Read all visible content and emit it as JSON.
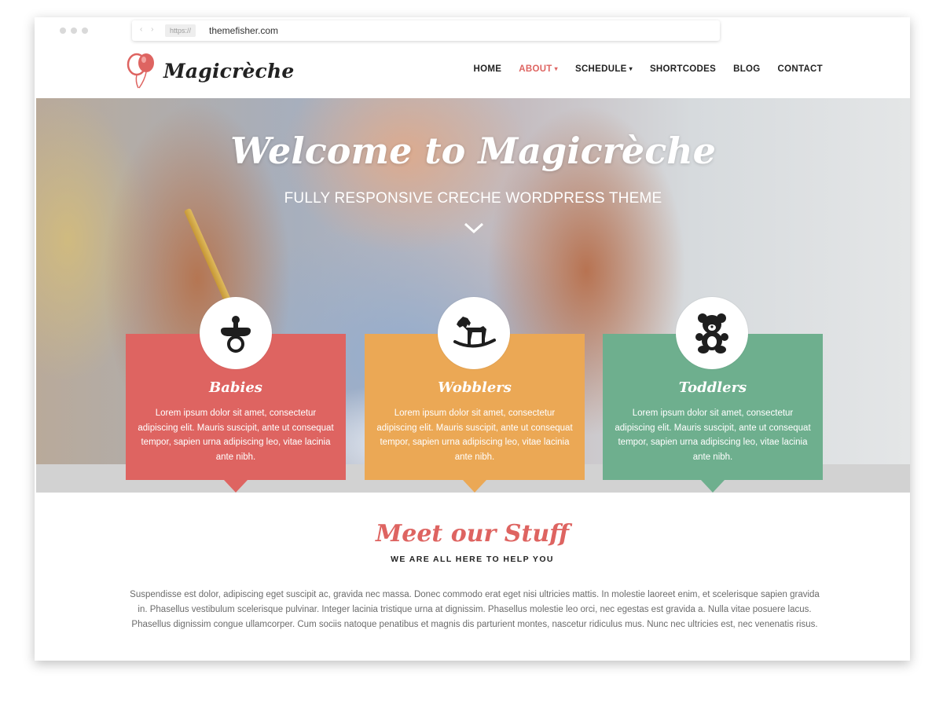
{
  "browser": {
    "url_protocol": "https://",
    "url_host": "themefisher.com"
  },
  "header": {
    "logo_text": "Magicrèche",
    "nav": [
      {
        "label": "HOME",
        "active": false,
        "dropdown": false
      },
      {
        "label": "ABOUT",
        "active": true,
        "dropdown": true
      },
      {
        "label": "SCHEDULE",
        "active": false,
        "dropdown": true
      },
      {
        "label": "SHORTCODES",
        "active": false,
        "dropdown": false
      },
      {
        "label": "BLOG",
        "active": false,
        "dropdown": false
      },
      {
        "label": "CONTACT",
        "active": false,
        "dropdown": false
      }
    ],
    "dropdown_caret": "▾"
  },
  "hero": {
    "title": "Welcome to Magicrèche",
    "subtitle": "FULLY RESPONSIVE CRECHE WORDPRESS THEME",
    "scroll_icon": "chevron-down-icon"
  },
  "features": [
    {
      "title": "Babies",
      "text": "Lorem ipsum dolor sit amet, consectetur adipiscing elit. Mauris suscipit, ante ut consequat tempor, sapien urna adipiscing leo, vitae lacinia ante nibh.",
      "icon": "pacifier-icon",
      "color": "#de6461"
    },
    {
      "title": "Wobblers",
      "text": "Lorem ipsum dolor sit amet, consectetur adipiscing elit. Mauris suscipit, ante ut consequat tempor, sapien urna adipiscing leo, vitae lacinia ante nibh.",
      "icon": "rocking-horse-icon",
      "color": "#eba855"
    },
    {
      "title": "Toddlers",
      "text": "Lorem ipsum dolor sit amet, consectetur adipiscing elit. Mauris suscipit, ante ut consequat tempor, sapien urna adipiscing leo, vitae lacinia ante nibh.",
      "icon": "teddy-bear-icon",
      "color": "#6eaf8e"
    }
  ],
  "staff_section": {
    "title": "Meet our Stuff",
    "subtitle": "WE ARE ALL HERE TO HELP YOU",
    "body": "Suspendisse est dolor, adipiscing eget suscipit ac, gravida nec massa. Donec commodo erat eget nisi ultricies mattis. In molestie laoreet enim, et scelerisque sapien gravida in. Phasellus vestibulum scelerisque pulvinar. Integer lacinia tristique urna at dignissim. Phasellus molestie leo orci, nec egestas est gravida a. Nulla vitae posuere lacus. Phasellus dignissim congue ullamcorper. Cum sociis natoque penatibus et magnis dis parturient montes, nascetur ridiculus mus. Nunc nec ultricies est, nec venenatis risus."
  },
  "colors": {
    "accent": "#de6461",
    "orange": "#eba855",
    "green": "#6eaf8e",
    "dark": "#222222"
  }
}
